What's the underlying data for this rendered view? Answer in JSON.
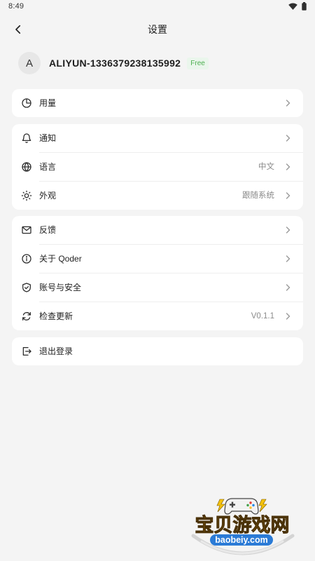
{
  "status_bar": {
    "time": "8:49",
    "icons": [
      "wifi-icon",
      "battery-icon"
    ]
  },
  "header": {
    "title": "设置",
    "back_icon": "chevron-left-icon"
  },
  "account": {
    "avatar_letter": "A",
    "username": "ALIYUN-1336379238135992",
    "plan_badge": "Free"
  },
  "groups": [
    {
      "items": [
        {
          "icon": "pie-chart-icon",
          "label": "用量"
        }
      ]
    },
    {
      "items": [
        {
          "icon": "bell-icon",
          "label": "通知"
        },
        {
          "icon": "globe-icon",
          "label": "语言",
          "value": "中文"
        },
        {
          "icon": "sun-icon",
          "label": "外观",
          "value": "跟随系统"
        }
      ]
    },
    {
      "items": [
        {
          "icon": "mail-icon",
          "label": "反馈"
        },
        {
          "icon": "info-icon",
          "label": "关于 Qoder"
        },
        {
          "icon": "shield-check-icon",
          "label": "账号与安全"
        },
        {
          "icon": "refresh-icon",
          "label": "检查更新",
          "value": "V0.1.1"
        }
      ]
    },
    {
      "items": [
        {
          "icon": "logout-icon",
          "label": "退出登录"
        }
      ]
    }
  ],
  "watermark": {
    "icon": "game-controller-icon",
    "name": "宝贝游戏网",
    "domain": "baobeiy.com"
  },
  "colors": {
    "page_bg": "#F4F4F4",
    "badge_text": "#4CAF50",
    "badge_bg": "#EAF6EC",
    "watermark_orange": "#F7A51C",
    "watermark_blue": "#2B7BD6"
  }
}
